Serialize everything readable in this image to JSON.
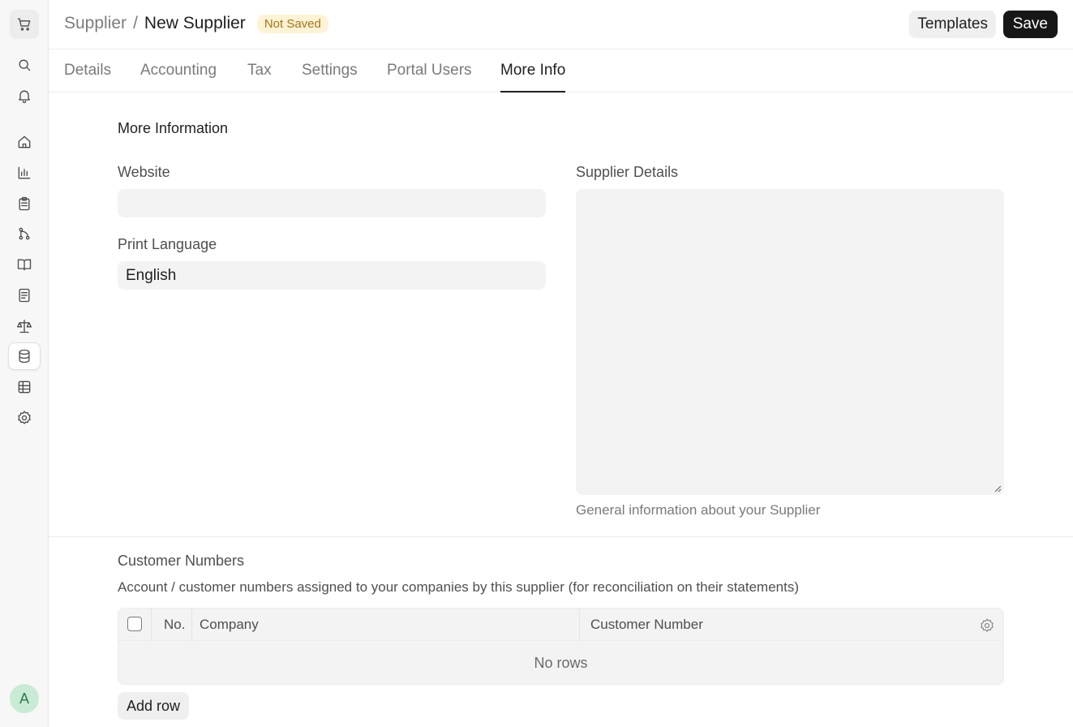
{
  "breadcrumb": {
    "parent": "Supplier",
    "separator": "/",
    "current": "New Supplier",
    "status": "Not Saved"
  },
  "header": {
    "templates_label": "Templates",
    "save_label": "Save"
  },
  "tabs": [
    {
      "label": "Details"
    },
    {
      "label": "Accounting"
    },
    {
      "label": "Tax"
    },
    {
      "label": "Settings"
    },
    {
      "label": "Portal Users"
    },
    {
      "label": "More Info",
      "active": true
    }
  ],
  "sidebar": {
    "icons": [
      "cart-icon",
      "search-icon",
      "bell-icon",
      "home-icon",
      "chart-icon",
      "clipboard-icon",
      "git-branch-icon",
      "book-icon",
      "document-icon",
      "scale-icon",
      "database-icon",
      "table-icon",
      "gear-icon"
    ],
    "active": "database-icon",
    "avatar": "A"
  },
  "form": {
    "section_title": "More Information",
    "website": {
      "label": "Website",
      "value": ""
    },
    "print_language": {
      "label": "Print Language",
      "value": "English"
    },
    "supplier_details": {
      "label": "Supplier Details",
      "value": "",
      "help": "General information about your Supplier"
    }
  },
  "customer_numbers": {
    "title": "Customer Numbers",
    "description": "Account / customer numbers assigned to your companies by this supplier (for reconciliation on their statements)",
    "columns": [
      "No.",
      "Company",
      "Customer Number"
    ],
    "empty_text": "No rows",
    "add_row_label": "Add row"
  },
  "colors": {
    "badge_bg": "#fff3d6",
    "badge_text": "#a0741b",
    "primary": "#171717"
  }
}
